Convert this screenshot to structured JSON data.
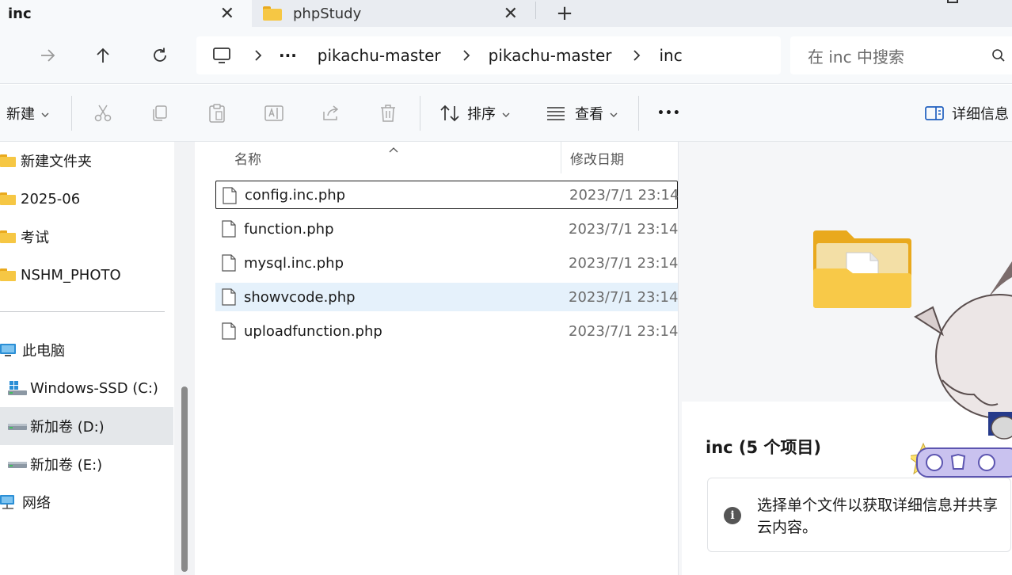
{
  "tabs": [
    {
      "label": "inc",
      "active": true
    },
    {
      "label": "phpStudy",
      "active": false
    }
  ],
  "breadcrumb": {
    "overflow": "···",
    "items": [
      "pikachu-master",
      "pikachu-master",
      "inc"
    ]
  },
  "search": {
    "placeholder": "在 inc 中搜索"
  },
  "toolbar": {
    "new_label": "新建",
    "sort_label": "排序",
    "view_label": "查看",
    "more_label": "•••",
    "details_label": "详细信息"
  },
  "sidebar": {
    "items": [
      {
        "label": "新建文件夹",
        "icon": "folder-icon"
      },
      {
        "label": "2025-06",
        "icon": "folder-icon"
      },
      {
        "label": "考试",
        "icon": "folder-icon"
      },
      {
        "label": "NSHM_PHOTO",
        "icon": "folder-icon"
      },
      {
        "label": "此电脑",
        "icon": "computer-icon"
      },
      {
        "label": "Windows-SSD (C:)",
        "icon": "windows-drive-icon"
      },
      {
        "label": "新加卷 (D:)",
        "icon": "drive-icon",
        "selected": true
      },
      {
        "label": "新加卷 (E:)",
        "icon": "drive-icon"
      },
      {
        "label": "网络",
        "icon": "network-icon"
      }
    ]
  },
  "filelist": {
    "columns": {
      "name": "名称",
      "date": "修改日期"
    },
    "rows": [
      {
        "name": "config.inc.php",
        "date": "2023/7/1 23:14"
      },
      {
        "name": "function.php",
        "date": "2023/7/1 23:14"
      },
      {
        "name": "mysql.inc.php",
        "date": "2023/7/1 23:14"
      },
      {
        "name": "showvcode.php",
        "date": "2023/7/1 23:14"
      },
      {
        "name": "uploadfunction.php",
        "date": "2023/7/1 23:14"
      }
    ]
  },
  "details": {
    "title": "inc (5 个项目)",
    "info": "选择单个文件以获取详细信息并共享云内容。"
  },
  "colors": {
    "folder": "#f6c744",
    "selected_row": "#e5f1fb",
    "chrome": "#f7f9fb"
  }
}
